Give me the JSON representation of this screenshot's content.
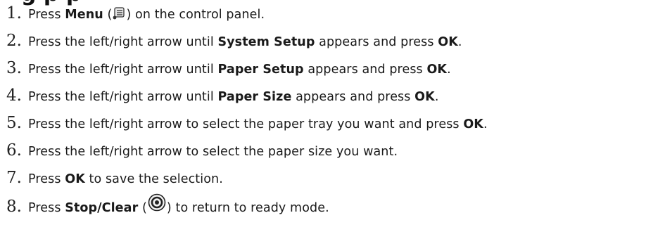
{
  "heading": "g   p  p",
  "steps": [
    {
      "num": "1.",
      "t1": "Press ",
      "b1": "Menu",
      "t2": " (",
      "icon": "menu-icon",
      "t3": ") on the control panel."
    },
    {
      "num": "2.",
      "t1": "Press the left/right arrow until ",
      "b1": "System Setup",
      "t2": " appears and press ",
      "b2": "OK",
      "t3": "."
    },
    {
      "num": "3.",
      "t1": "Press the left/right arrow until ",
      "b1": "Paper Setup",
      "t2": " appears and press ",
      "b2": "OK",
      "t3": "."
    },
    {
      "num": "4.",
      "t1": "Press the left/right arrow until ",
      "b1": "Paper Size",
      "t2": " appears and press ",
      "b2": "OK",
      "t3": "."
    },
    {
      "num": "5.",
      "t1": "Press the left/right arrow to select the paper tray you want and press ",
      "b1": "OK",
      "t2": "."
    },
    {
      "num": "6.",
      "t1": "Press the left/right arrow to select the paper size you want."
    },
    {
      "num": "7.",
      "t1": "Press ",
      "b1": "OK",
      "t2": " to save the selection."
    },
    {
      "num": "8.",
      "t1": "Press ",
      "b1": "Stop/Clear",
      "t2": " (",
      "icon": "stop-clear-icon",
      "t3": ") to return to ready mode."
    }
  ]
}
